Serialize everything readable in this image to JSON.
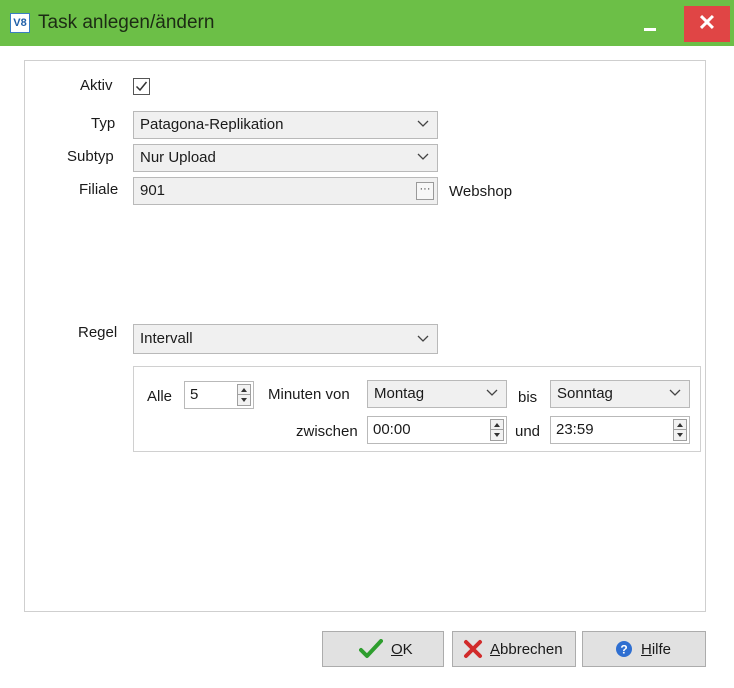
{
  "window": {
    "logo": "V8",
    "title": "Task anlegen/ändern",
    "minimize_glyph": "_",
    "close_glyph": "✕"
  },
  "form": {
    "aktiv_label": "Aktiv",
    "aktiv_checked": true,
    "typ_label": "Typ",
    "typ_value": "Patagona-Replikation",
    "subtyp_label": "Subtyp",
    "subtyp_value": "Nur Upload",
    "filiale_label": "Filiale",
    "filiale_value": "901",
    "filiale_browse": "···",
    "filiale_name": "Webshop",
    "regel_label": "Regel",
    "regel_value": "Intervall"
  },
  "interval": {
    "alle_label": "Alle",
    "alle_value": "5",
    "minuten_von_label": "Minuten von",
    "from_day": "Montag",
    "bis_label": "bis",
    "to_day": "Sonntag",
    "zwischen_label": "zwischen",
    "from_time": "00:00",
    "und_label": "und",
    "to_time": "23:59"
  },
  "buttons": {
    "ok_prefix": "",
    "ok_mnemonic": "O",
    "ok_rest": "K",
    "cancel_mnemonic": "A",
    "cancel_rest": "bbrechen",
    "help_mnemonic": "H",
    "help_rest": "ilfe"
  },
  "colors": {
    "titlebar": "#6cbf47",
    "close_button": "#e04545",
    "ok_icon": "#2e9e2e",
    "cancel_icon": "#d12b2b",
    "help_icon": "#2f6fd1"
  },
  "icons": {
    "ok": "checkmark-icon",
    "cancel": "x-icon",
    "help": "help-icon",
    "dropdown": "chevron-down-icon"
  }
}
